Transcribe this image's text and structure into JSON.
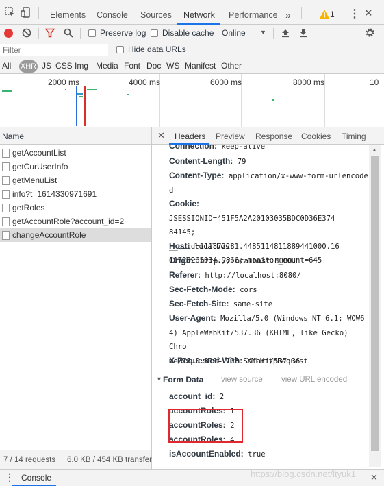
{
  "topbar": {
    "tabs": [
      "Elements",
      "Console",
      "Sources",
      "Network",
      "Performance"
    ],
    "active_tab": "Network",
    "more": "»",
    "warning_count": "1",
    "menu": "⋮",
    "close": "✕"
  },
  "toolbar": {
    "preserve_log": "Preserve log",
    "disable_cache": "Disable cache",
    "throttle": "Online",
    "throttle_arrow": "▼"
  },
  "filter": {
    "placeholder": "Filter",
    "hide_data_urls": "Hide data URLs"
  },
  "types": [
    "All",
    "XHR",
    "JS",
    "CSS",
    "Img",
    "Media",
    "Font",
    "Doc",
    "WS",
    "Manifest",
    "Other"
  ],
  "active_type": "XHR",
  "timeline": {
    "ticks": [
      "2000 ms",
      "4000 ms",
      "6000 ms",
      "8000 ms",
      "10"
    ]
  },
  "requests": {
    "header": "Name",
    "items": [
      "getAccountList",
      "getCurUserInfo",
      "getMenuList",
      "info?t=1614330971691",
      "getRoles",
      "getAccountRole?account_id=2",
      "changeAccountRole"
    ],
    "selected_index": 6
  },
  "status": {
    "requests": "7 / 14 requests",
    "transfer": "6.0 KB / 454 KB transfer"
  },
  "detail": {
    "close": "✕",
    "tabs": [
      "Headers",
      "Preview",
      "Response",
      "Cookies",
      "Timing"
    ],
    "active_tab": "Headers",
    "headers": [
      {
        "name": "Connection:",
        "value": "keep-alive"
      },
      {
        "name": "Content-Length:",
        "value": "79"
      },
      {
        "name": "Content-Type:",
        "value": "application/x-www-form-urlencode",
        "cont": [
          "d"
        ]
      },
      {
        "name": "Cookie:",
        "value": "JSESSIONID=451F5A2A20103035BDC0D36E374",
        "cont": [
          "84145;  __guid=111872281.4485114811889441000.16",
          "11728265034.9866; monitor_count=645"
        ]
      },
      {
        "name": "Host:",
        "value": "localhost"
      },
      {
        "name": "Origin:",
        "value": "http://localhost:8080"
      },
      {
        "name": "Referer:",
        "value": "http://localhost:8080/"
      },
      {
        "name": "Sec-Fetch-Mode:",
        "value": "cors"
      },
      {
        "name": "Sec-Fetch-Site:",
        "value": "same-site"
      },
      {
        "name": "User-Agent:",
        "value": "Mozilla/5.0 (Windows NT 6.1; WOW6",
        "cont": [
          "4) AppleWebKit/537.36 (KHTML, like Gecko) Chro",
          "me/78.0.3904.108 Safari/537.36"
        ]
      },
      {
        "name": "X-Requested-With:",
        "value": "XMLHttpRequest"
      }
    ],
    "form_data": {
      "title": "Form Data",
      "view_source": "view source",
      "view_url_encoded": "view URL encoded",
      "fields": [
        {
          "name": "account_id:",
          "value": "2"
        },
        {
          "name": "accountRoles:",
          "value": "1"
        },
        {
          "name": "accountRoles:",
          "value": "2"
        },
        {
          "name": "accountRoles:",
          "value": "4"
        },
        {
          "name": "isAccountEnabled:",
          "value": "true"
        }
      ]
    }
  },
  "drawer": {
    "menu": "⋮",
    "tab": "Console",
    "close": "✕"
  },
  "watermark": "https://blog.csdn.net/ityuk1",
  "colors": {
    "accent": "#1a73e8",
    "record": "#e53935",
    "filter_active": "#d93025",
    "highlight": "#e0282e"
  }
}
